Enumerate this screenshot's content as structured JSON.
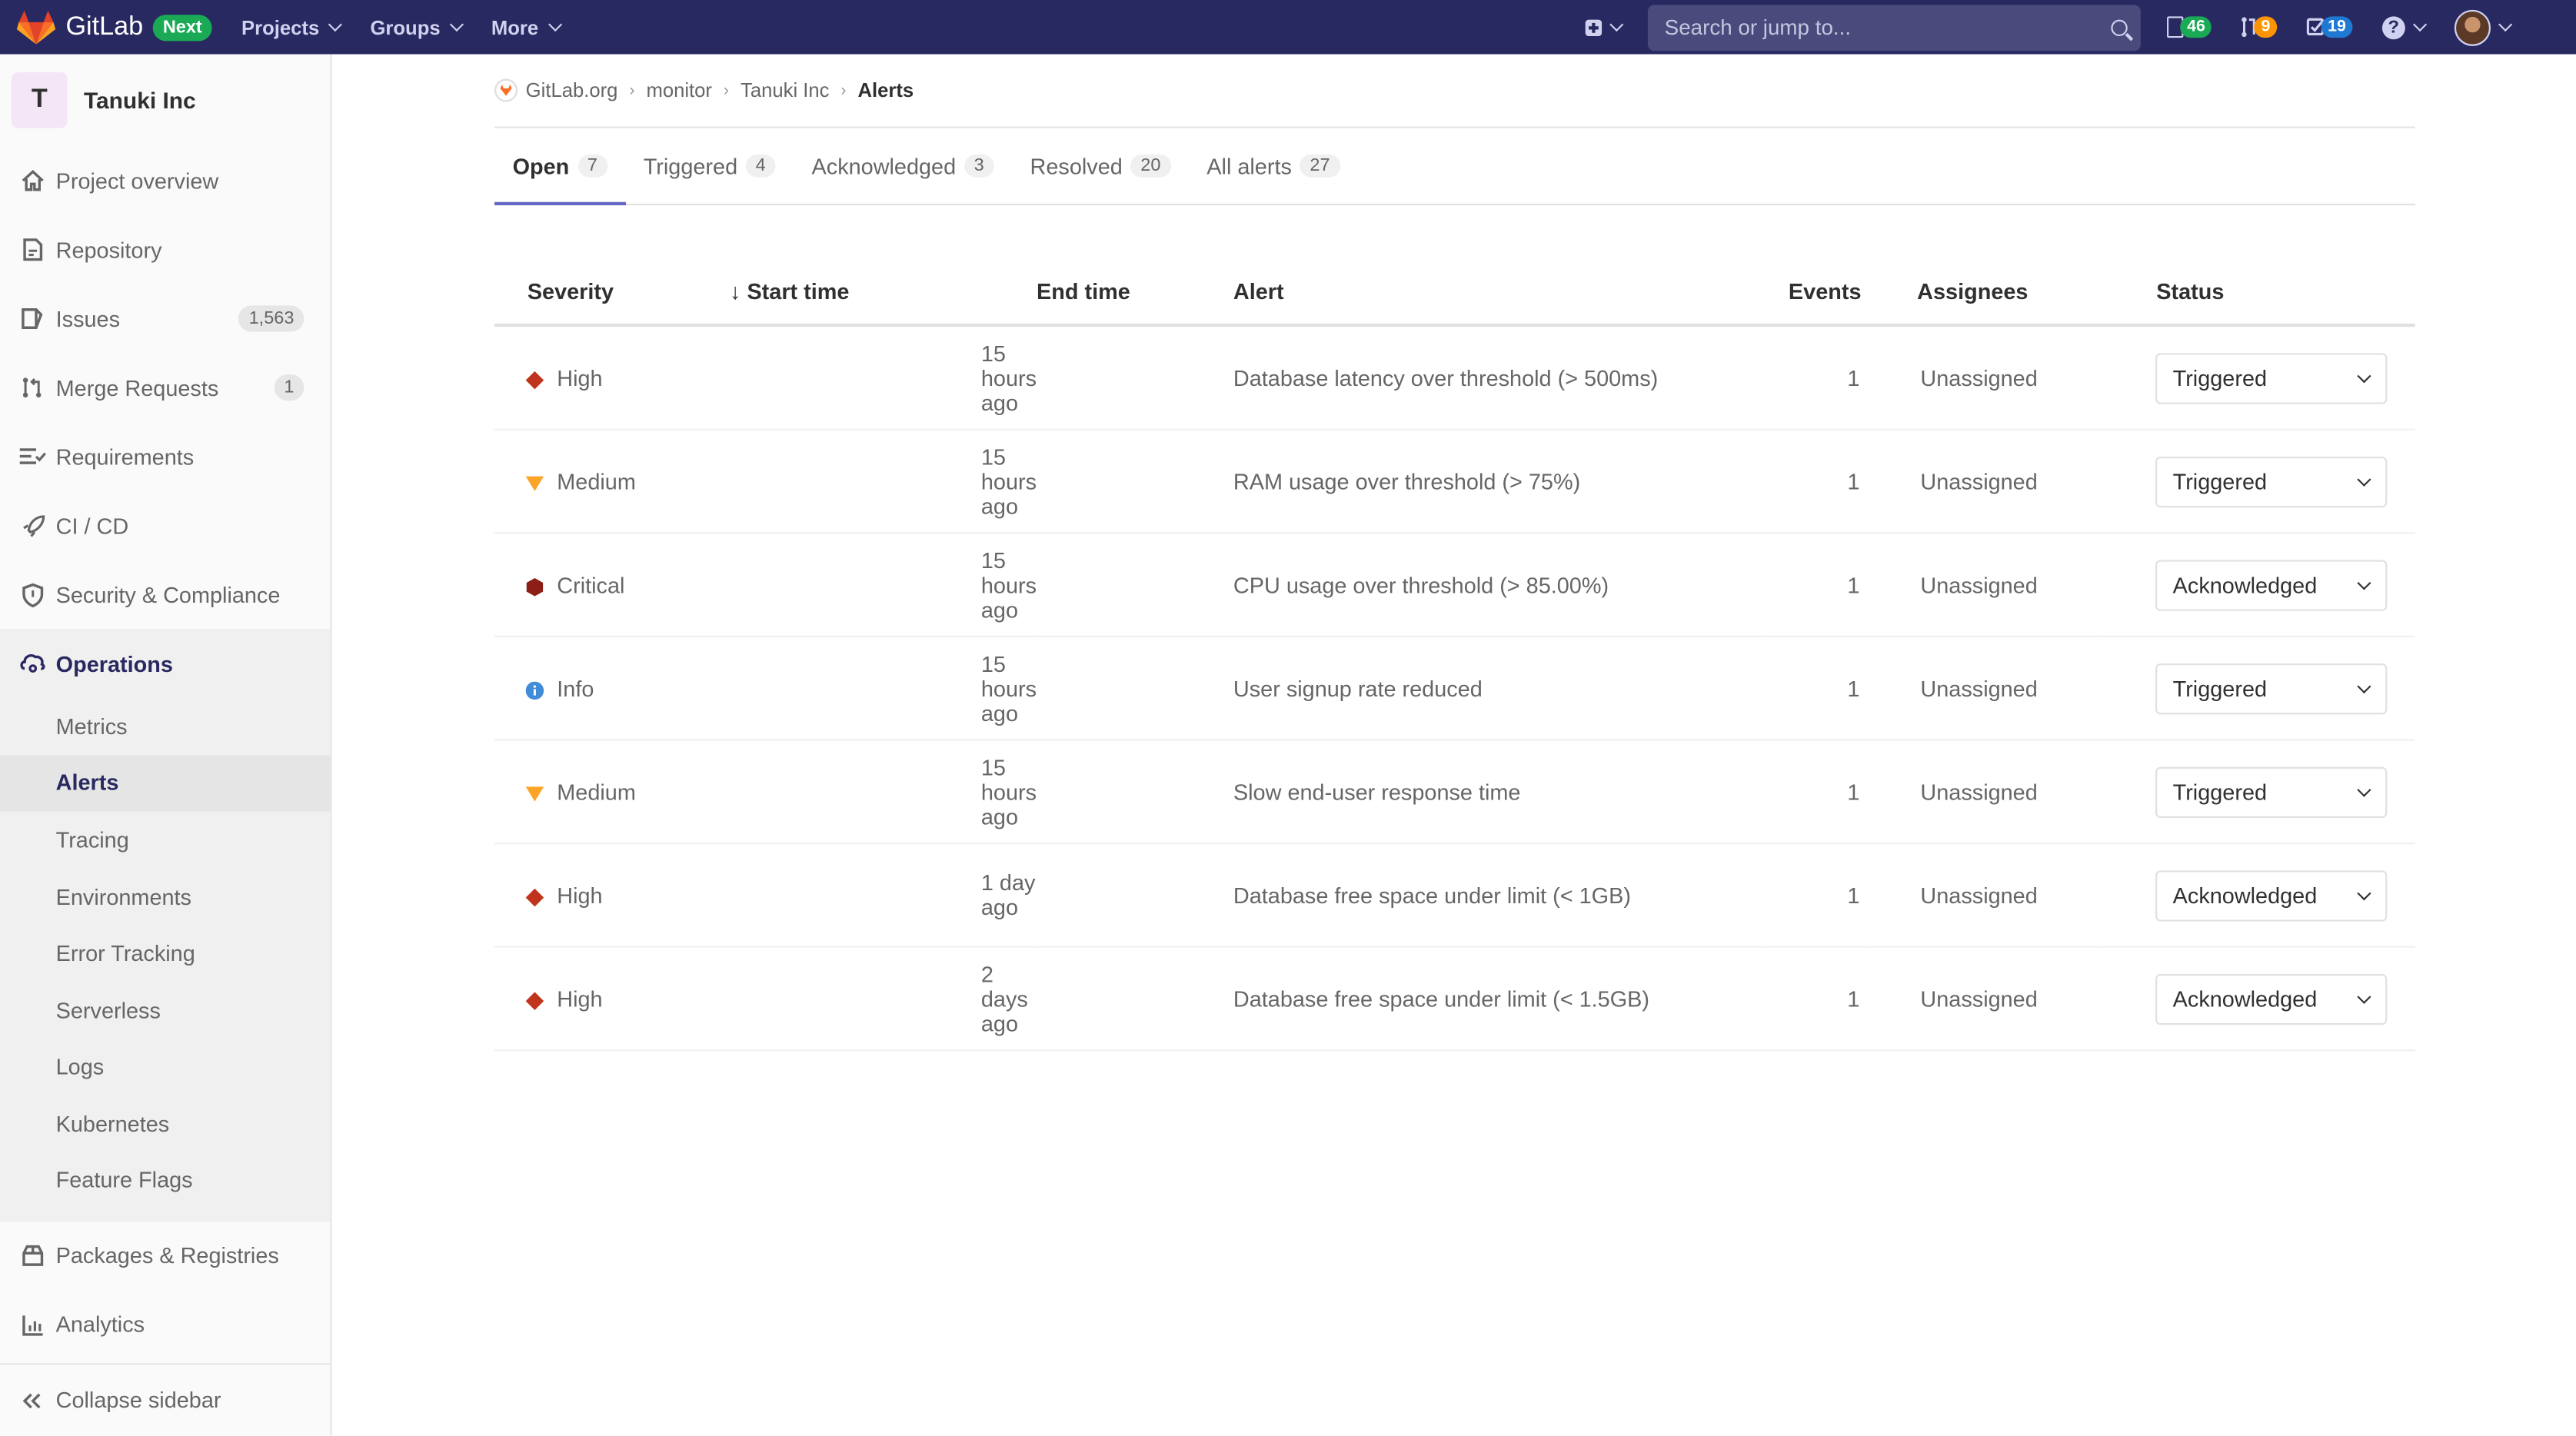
{
  "topbar": {
    "brand": "GitLab",
    "badge": "Next",
    "nav": [
      "Projects",
      "Groups",
      "More"
    ],
    "search_placeholder": "Search or jump to...",
    "counters": [
      {
        "icon": "issues-icon",
        "value": "46",
        "color": "#1aaa55"
      },
      {
        "icon": "merge-request-icon",
        "value": "9",
        "color": "#fc9403"
      },
      {
        "icon": "todo-icon",
        "value": "19",
        "color": "#1f78d1"
      }
    ],
    "help": "?"
  },
  "sidebar": {
    "project_initial": "T",
    "project_name": "Tanuki Inc",
    "items": [
      {
        "label": "Project overview",
        "icon": "home-icon"
      },
      {
        "label": "Repository",
        "icon": "document-icon"
      },
      {
        "label": "Issues",
        "icon": "issues-icon",
        "badge": "1,563"
      },
      {
        "label": "Merge Requests",
        "icon": "merge-request-icon",
        "badge": "1"
      },
      {
        "label": "Requirements",
        "icon": "requirements-icon"
      },
      {
        "label": "CI / CD",
        "icon": "rocket-icon"
      },
      {
        "label": "Security & Compliance",
        "icon": "shield-icon"
      }
    ],
    "operations": {
      "label": "Operations",
      "icon": "cloud-gear-icon",
      "sub": [
        "Metrics",
        "Alerts",
        "Tracing",
        "Environments",
        "Error Tracking",
        "Serverless",
        "Logs",
        "Kubernetes",
        "Feature Flags"
      ],
      "active_sub": "Alerts"
    },
    "bottom_items": [
      {
        "label": "Packages & Registries",
        "icon": "package-icon"
      },
      {
        "label": "Analytics",
        "icon": "chart-icon"
      }
    ],
    "collapse": "Collapse sidebar"
  },
  "breadcrumb": [
    "GitLab.org",
    "monitor",
    "Tanuki Inc",
    "Alerts"
  ],
  "tabs": [
    {
      "label": "Open",
      "count": "7",
      "active": true
    },
    {
      "label": "Triggered",
      "count": "4"
    },
    {
      "label": "Acknowledged",
      "count": "3"
    },
    {
      "label": "Resolved",
      "count": "20"
    },
    {
      "label": "All alerts",
      "count": "27"
    }
  ],
  "table": {
    "columns": [
      "Severity",
      "Start time",
      "End time",
      "Alert",
      "Events",
      "Assignees",
      "Status"
    ],
    "sort_indicator": "↓",
    "rows": [
      {
        "severity": "High",
        "start": "15 hours ago",
        "end": "",
        "alert": "Database latency over threshold (> 500ms)",
        "events": "1",
        "assignees": "Unassigned",
        "status": "Triggered"
      },
      {
        "severity": "Medium",
        "start": "15 hours ago",
        "end": "",
        "alert": "RAM usage over threshold (> 75%)",
        "events": "1",
        "assignees": "Unassigned",
        "status": "Triggered"
      },
      {
        "severity": "Critical",
        "start": "15 hours ago",
        "end": "",
        "alert": "CPU usage over threshold (> 85.00%)",
        "events": "1",
        "assignees": "Unassigned",
        "status": "Acknowledged"
      },
      {
        "severity": "Info",
        "start": "15 hours ago",
        "end": "",
        "alert": "User signup rate reduced",
        "events": "1",
        "assignees": "Unassigned",
        "status": "Triggered"
      },
      {
        "severity": "Medium",
        "start": "15 hours ago",
        "end": "",
        "alert": "Slow end-user response time",
        "events": "1",
        "assignees": "Unassigned",
        "status": "Triggered"
      },
      {
        "severity": "High",
        "start": "1 day ago",
        "end": "",
        "alert": "Database free space under limit (< 1GB)",
        "events": "1",
        "assignees": "Unassigned",
        "status": "Acknowledged"
      },
      {
        "severity": "High",
        "start": "2 days ago",
        "end": "",
        "alert": "Database free space under limit (< 1.5GB)",
        "events": "1",
        "assignees": "Unassigned",
        "status": "Acknowledged"
      }
    ]
  },
  "severity_colors": {
    "Critical": "#8d1e15",
    "High": "#c0341d",
    "Medium": "#fca429",
    "Info": "#418cd8"
  }
}
